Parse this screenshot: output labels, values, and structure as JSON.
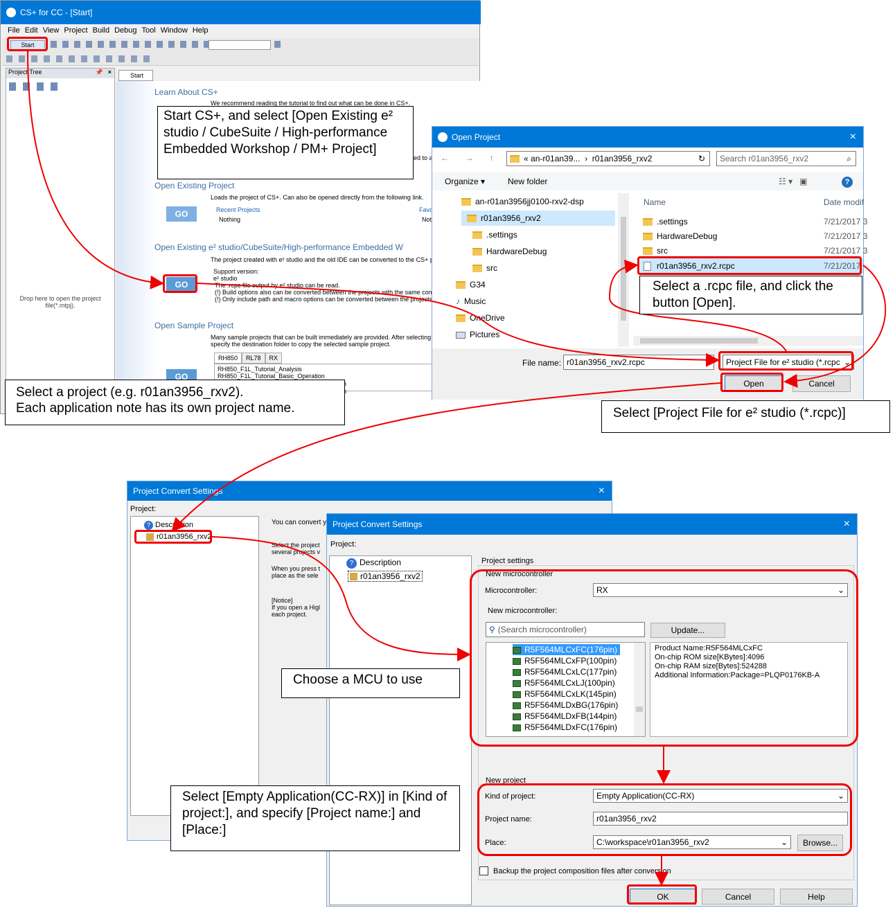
{
  "cs": {
    "title": "CS+ for CC - [Start]",
    "menu": [
      "File",
      "Edit",
      "View",
      "Project",
      "Build",
      "Debug",
      "Tool",
      "Window",
      "Help"
    ],
    "start_button": "Start",
    "project_tree_label": "Project Tree",
    "start_tab": "Start",
    "drop_hint_1": "Drop here to open the project",
    "drop_hint_2": "file(*.mtpj).",
    "learn_title": "Learn About CS+",
    "learn_text": "We recommend reading the tutorial to find out what can be done in CS+.",
    "learn_tail": "ed to a",
    "open_existing_title": "Open Existing Project",
    "open_existing_text": "Loads the project of CS+. Can also be opened directly from the following link.",
    "go": "GO",
    "recent_projects": "Recent Projects",
    "nothing": "Nothing",
    "favo": "Favo",
    "not": "Not",
    "e2_title": "Open Existing e² studio/CubeSuite/High-performance Embedded W",
    "e2_text": "The project created with e² studio and the old IDE can be converted to the CS+ pr",
    "support_version": "Support version:",
    "e2_studio": "e² studio",
    "rcpc_line": "The .rcpc file output by e² studio can be read.",
    "build_opts_line": "(!) Build options also can be converted between the projects with the same compile",
    "path_macro_line": "(!) Only include path and macro options can be converted between the projects with",
    "sample_title": "Open Sample Project",
    "sample_text_1": "Many sample projects that can be built immediately are provided. After selecting",
    "sample_text_2": "specify the destination folder to copy the selected sample project.",
    "sample_tabs": [
      "RH850",
      "RL78",
      "RX"
    ],
    "sample_items": [
      "RH850_F1L_Tutorial_Analysis",
      "RH850_F1L_Tutorial_Basic_Operation"
    ],
    "sample_tail_1": "n",
    "sample_tail_2": "n"
  },
  "open_dialog": {
    "title": "Open Project",
    "breadcrumb": [
      "an-r01an39...",
      "r01an3956_rxv2"
    ],
    "search_placeholder": "Search r01an3956_rxv2",
    "organize": "Organize ▾",
    "new_folder": "New folder",
    "nav_items": [
      "an-r01an3956jj0100-rxv2-dsp",
      "r01an3956_rxv2",
      ".settings",
      "HardwareDebug",
      "src",
      "G34",
      "Music",
      "OneDrive",
      "Pictures"
    ],
    "col_name": "Name",
    "col_date": "Date modif",
    "files": [
      {
        "name": ".settings",
        "date": "7/21/2017 3"
      },
      {
        "name": "HardwareDebug",
        "date": "7/21/2017 3"
      },
      {
        "name": "src",
        "date": "7/21/2017 3"
      },
      {
        "name": "r01an3956_rxv2.rcpc",
        "date": "7/21/2017"
      }
    ],
    "file_name_label": "File name:",
    "file_name_value": "r01an3956_rxv2.rcpc",
    "filter_value": "Project File for e² studio (*.rcpc",
    "open_button": "Open",
    "cancel_button": "Cancel"
  },
  "convert_back": {
    "title": "Project Convert Settings",
    "project_label": "Project:",
    "tree": [
      "Description",
      "r01an3956_rxv2"
    ],
    "text_1": "You can convert y",
    "text_2": "Select the project",
    "text_3": "several projects v",
    "text_4": "When you press t",
    "text_5": "place as the sele",
    "notice_1": "[Notice]",
    "notice_2": "If you open a Higl",
    "notice_3": "each project."
  },
  "convert_front": {
    "title": "Project Convert Settings",
    "project_label": "Project:",
    "tree": [
      "Description",
      "r01an3956_rxv2"
    ],
    "project_settings": "Project settings",
    "new_micro_group": "New microcontroller",
    "microcontroller_label": "Microcontroller:",
    "microcontroller_value": "RX",
    "new_micro_label": "New microcontroller:",
    "search_placeholder": "(Search microcontroller)",
    "update_button": "Update...",
    "mcus": [
      "R5F564MLCxFC(176pin)",
      "R5F564MLCxFP(100pin)",
      "R5F564MLCxLC(177pin)",
      "R5F564MLCxLJ(100pin)",
      "R5F564MLCxLK(145pin)",
      "R5F564MLDxBG(176pin)",
      "R5F564MLDxFB(144pin)",
      "R5F564MLDxFC(176pin)"
    ],
    "info": [
      "Product Name:R5F564MLCxFC",
      "On-chip ROM size[KBytes]:4096",
      "On-chip RAM size[Bytes]:524288",
      "Additional Information:Package=PLQP0176KB-A"
    ],
    "new_project_group": "New project",
    "kind_label": "Kind of project:",
    "kind_value": "Empty Application(CC-RX)",
    "name_label": "Project name:",
    "name_value": "r01an3956_rxv2",
    "place_label": "Place:",
    "place_value": "C:\\workspace\\r01an3956_rxv2",
    "browse_button": "Browse...",
    "backup_label": "Backup the project composition files after conversion",
    "ok_button": "OK",
    "cancel_button": "Cancel",
    "help_button": "Help"
  },
  "callouts": {
    "c1": "Start CS+, and select [Open Existing e² studio / CubeSuite / High-performance Embedded Workshop / PM+ Project]",
    "c2_1": "Select a project (e.g. r01an3956_rxv2).",
    "c2_2": "Each application note has its own project name.",
    "c3": "Select a .rcpc file, and click the button [Open].",
    "c4": "Select [Project File for e² studio (*.rcpc)]",
    "c5": "Choose a MCU to use",
    "c6": "Select [Empty Application(CC-RX)] in [Kind of project:], and specify [Project name:] and [Place:]"
  },
  "colors": {
    "accent": "#0078d7",
    "highlight": "#e00000",
    "go_button": "#5b9bd5"
  }
}
